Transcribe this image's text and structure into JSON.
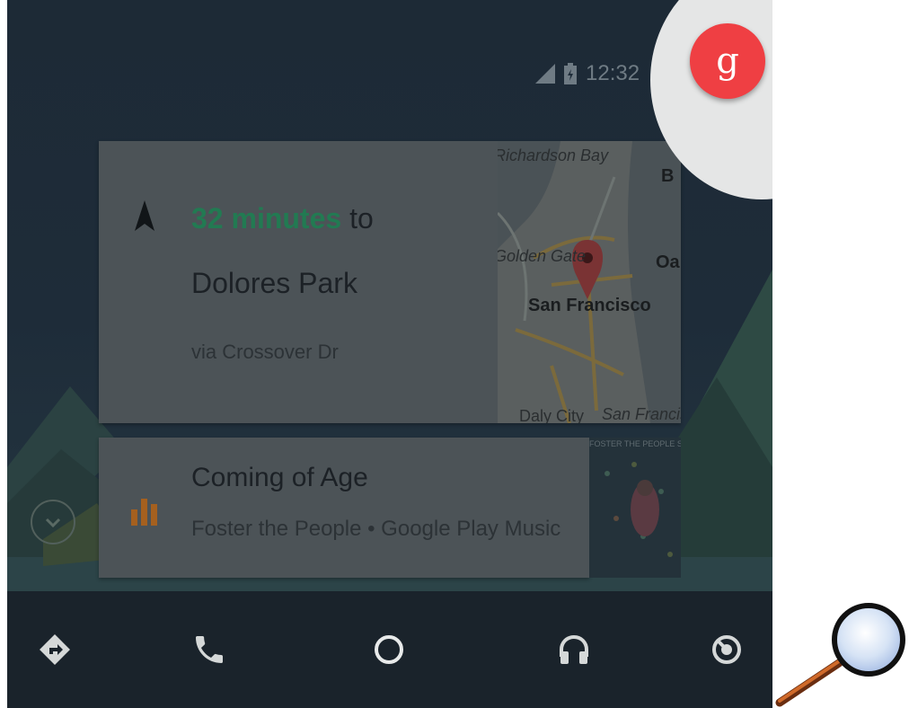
{
  "status": {
    "time": "12:32"
  },
  "navigation": {
    "eta_highlight": "32 minutes",
    "destination": "to Dolores Park",
    "route": "via Crossover Dr"
  },
  "map": {
    "labels": [
      "Richardson Bay",
      "Golden Gate",
      "San Francisco",
      "Oa",
      "Daly City",
      "San Francis",
      "B"
    ]
  },
  "media": {
    "title": "Coming of Age",
    "subtitle": "Foster the People • Google Play Music",
    "album_text": "FOSTER THE PEOPLE  SUPERMODEL"
  },
  "voice": {
    "glyph": "g"
  },
  "icons": [
    "navigation-arrow-icon",
    "directions-icon",
    "phone-icon",
    "home-icon",
    "headphones-icon",
    "exit-icon",
    "chevron-down-icon",
    "equalizer-icon",
    "signal-icon",
    "battery-charging-icon",
    "google-voice-icon",
    "magnifier-icon"
  ],
  "colors": {
    "eta_green": "#227a52",
    "voice_red": "#ef3f43",
    "media_orange": "#a5601f"
  }
}
